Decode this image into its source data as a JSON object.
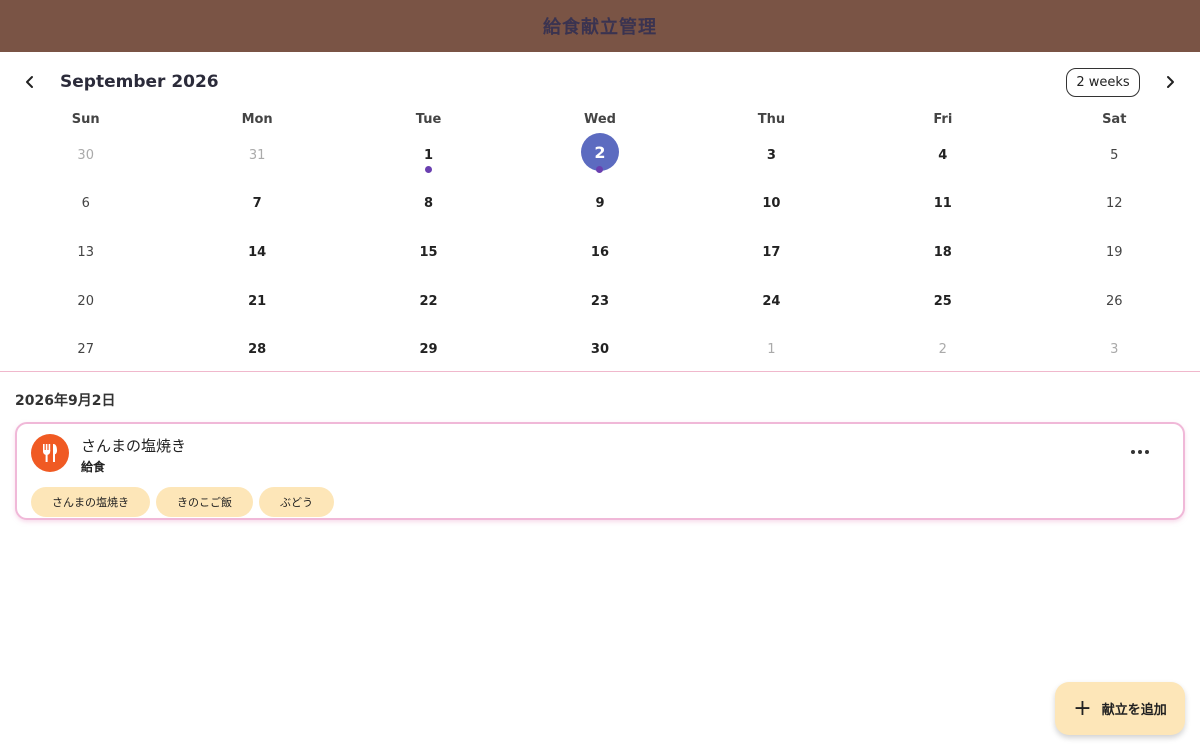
{
  "appbar": {
    "title": "給食献立管理",
    "bg_color": "#7a5445"
  },
  "calendar": {
    "month_label": "September 2026",
    "format_button": "2 weeks",
    "prev_icon": "chevron-left-icon",
    "next_icon": "chevron-right-icon",
    "days_of_week": [
      "Sun",
      "Mon",
      "Tue",
      "Wed",
      "Thu",
      "Fri",
      "Sat"
    ],
    "selected_day": "2",
    "selected_color": "#5c6bc0",
    "weeks": [
      [
        {
          "d": "30",
          "outside": true
        },
        {
          "d": "31",
          "outside": true
        },
        {
          "d": "1",
          "marker": true
        },
        {
          "d": "2",
          "selected": true,
          "marker": true
        },
        {
          "d": "3"
        },
        {
          "d": "4"
        },
        {
          "d": "5"
        }
      ],
      [
        {
          "d": "6"
        },
        {
          "d": "7"
        },
        {
          "d": "8"
        },
        {
          "d": "9"
        },
        {
          "d": "10"
        },
        {
          "d": "11"
        },
        {
          "d": "12"
        }
      ],
      [
        {
          "d": "13"
        },
        {
          "d": "14"
        },
        {
          "d": "15"
        },
        {
          "d": "16"
        },
        {
          "d": "17"
        },
        {
          "d": "18"
        },
        {
          "d": "19"
        }
      ],
      [
        {
          "d": "20"
        },
        {
          "d": "21"
        },
        {
          "d": "22"
        },
        {
          "d": "23"
        },
        {
          "d": "24"
        },
        {
          "d": "25"
        },
        {
          "d": "26"
        }
      ],
      [
        {
          "d": "27"
        },
        {
          "d": "28"
        },
        {
          "d": "29"
        },
        {
          "d": "30"
        },
        {
          "d": "1",
          "outside": true
        },
        {
          "d": "2",
          "outside": true
        },
        {
          "d": "3",
          "outside": true
        }
      ]
    ]
  },
  "selected_date_heading": "2026年9月2日",
  "meal": {
    "icon": "fork-knife-icon",
    "icon_color": "#f05a23",
    "title": "さんまの塩焼き",
    "type": "給食",
    "more_icon": "more-horizontal-icon",
    "dishes": [
      "さんまの塩焼き",
      "きのこご飯",
      "ぶどう"
    ]
  },
  "fab": {
    "icon": "plus-icon",
    "label": "献立を追加",
    "bg_color": "#fde6b8"
  }
}
